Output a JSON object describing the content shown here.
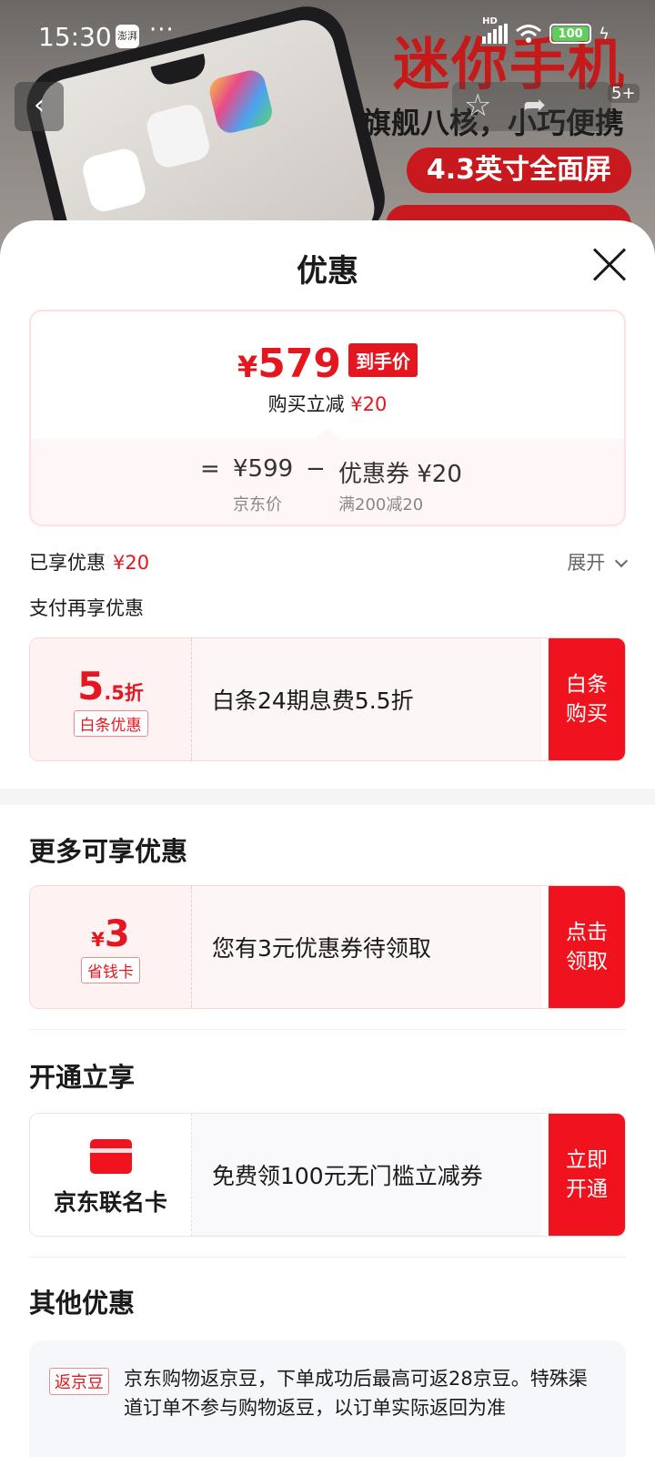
{
  "status_bar": {
    "time": "15:30",
    "app_icon_text": "澎湃",
    "dots": "···",
    "network": "HD",
    "battery": "100"
  },
  "banner": {
    "title": "迷你手机",
    "subtitle": "旗舰八核，小巧便携",
    "pill": "4.3英寸全面屏",
    "more_count": "5+"
  },
  "sheet": {
    "title": "优惠",
    "price": {
      "currency": "¥",
      "final": "579",
      "tag": "到手价",
      "instant_label": "购买立减",
      "instant_value": "¥20",
      "eq": "=",
      "jd_price": "¥599",
      "jd_label": "京东价",
      "minus": "−",
      "coupon": "优惠券 ¥20",
      "coupon_rule": "满200减20"
    },
    "enjoyed_label": "已享优惠",
    "enjoyed_value": "¥20",
    "expand_label": "展开",
    "pay_more_label": "支付再享优惠",
    "baitiao": {
      "discount_big": "5",
      "discount_small": ".5折",
      "badge": "白条优惠",
      "desc": "白条24期息费5.5折",
      "button": "白条购买"
    },
    "more_title": "更多可享优惠",
    "coupon_card": {
      "currency": "¥",
      "amount": "3",
      "badge": "省钱卡",
      "desc": "您有3元优惠券待领取",
      "button": "点击领取"
    },
    "open_title": "开通立享",
    "cobrand": {
      "name": "京东联名卡",
      "desc": "免费领100元无门槛立减券",
      "button": "立即开通"
    },
    "other_title": "其他优惠",
    "other": {
      "badge": "返京豆",
      "text": "京东购物返京豆，下单成功后最高可返28京豆。特殊渠道订单不参与购物返豆，以订单实际返回为准"
    }
  },
  "colors": {
    "accent": "#f0131e",
    "price_red": "#e4161f"
  },
  "icons": [
    "back-icon",
    "star-icon",
    "share-icon",
    "close-icon",
    "chevron-down-icon",
    "credit-card-icon"
  ]
}
